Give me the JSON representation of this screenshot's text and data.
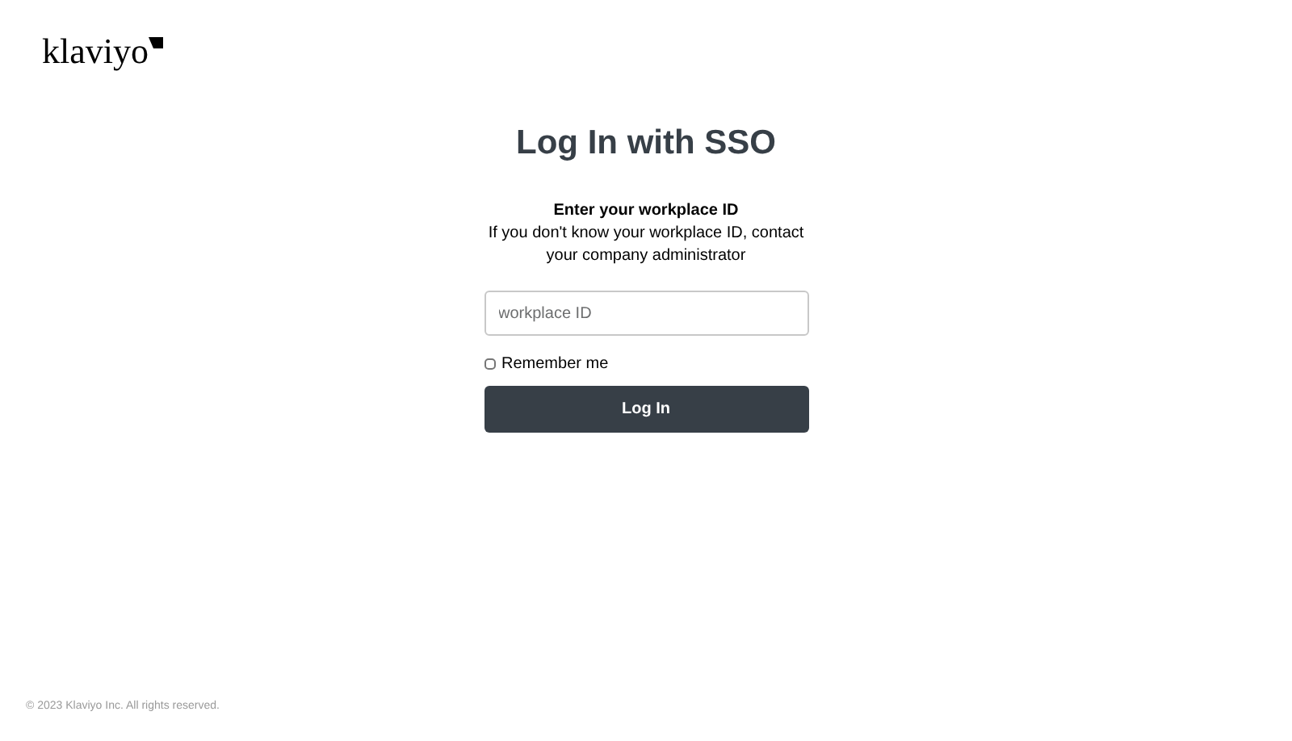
{
  "logo": {
    "text": "klaviyo"
  },
  "title": "Log In with SSO",
  "subtitle": "Enter your workplace ID",
  "help": "If you don't know your workplace ID, contact your company administrator",
  "field": {
    "placeholder": "workplace ID"
  },
  "remember": {
    "label": "Remember me",
    "checked": false
  },
  "submit": "Log In",
  "footer": "© 2023 Klaviyo Inc. All rights reserved."
}
